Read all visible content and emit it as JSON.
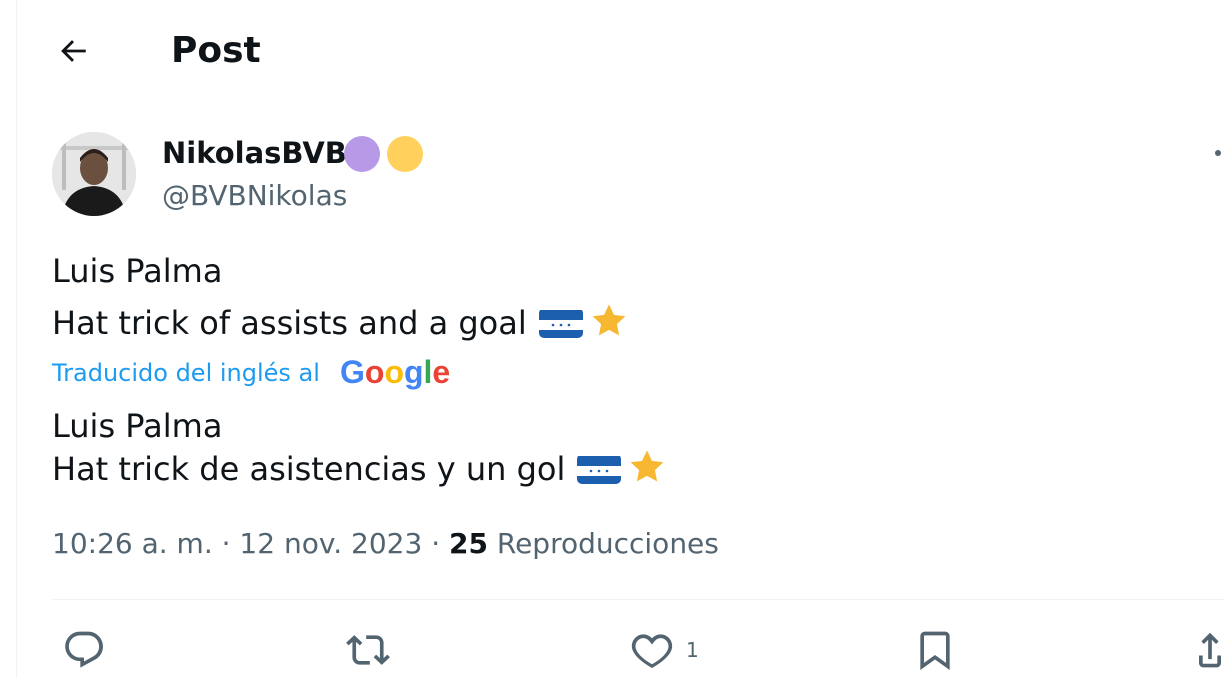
{
  "header": {
    "title": "Post",
    "back_icon": "arrow-left-icon"
  },
  "author": {
    "display_name": "NikolasBVB",
    "handle": "@BVBNikolas",
    "badges": [
      {
        "icon": "purple-circle-icon",
        "color": "#b799e8"
      },
      {
        "icon": "yellow-circle-icon",
        "color": "#ffd15c"
      }
    ]
  },
  "post": {
    "original_lines": [
      "Luis Palma",
      "Hat trick of assists and a goal"
    ],
    "translated_label": "Traducido del inglés al",
    "translation_provider": "Google",
    "translated_lines": [
      "Luis Palma",
      "Hat trick de asistencias y un gol"
    ],
    "emojis": [
      "honduras-flag-icon",
      "star-icon"
    ]
  },
  "meta": {
    "time": "10:26 a. m. · 12 nov. 2023 · ",
    "views_count": "25",
    "views_label": " Reproducciones"
  },
  "actions": {
    "reply": {
      "icon": "reply-icon"
    },
    "repost": {
      "icon": "repost-icon"
    },
    "like": {
      "icon": "heart-icon",
      "count": "1"
    },
    "bookmark": {
      "icon": "bookmark-icon"
    },
    "share": {
      "icon": "share-icon"
    }
  },
  "colors": {
    "link_blue": "#1d9bf0",
    "secondary_text": "#536471",
    "flag_blue": "#1b5fae",
    "star_yellow": "#f7b731"
  }
}
